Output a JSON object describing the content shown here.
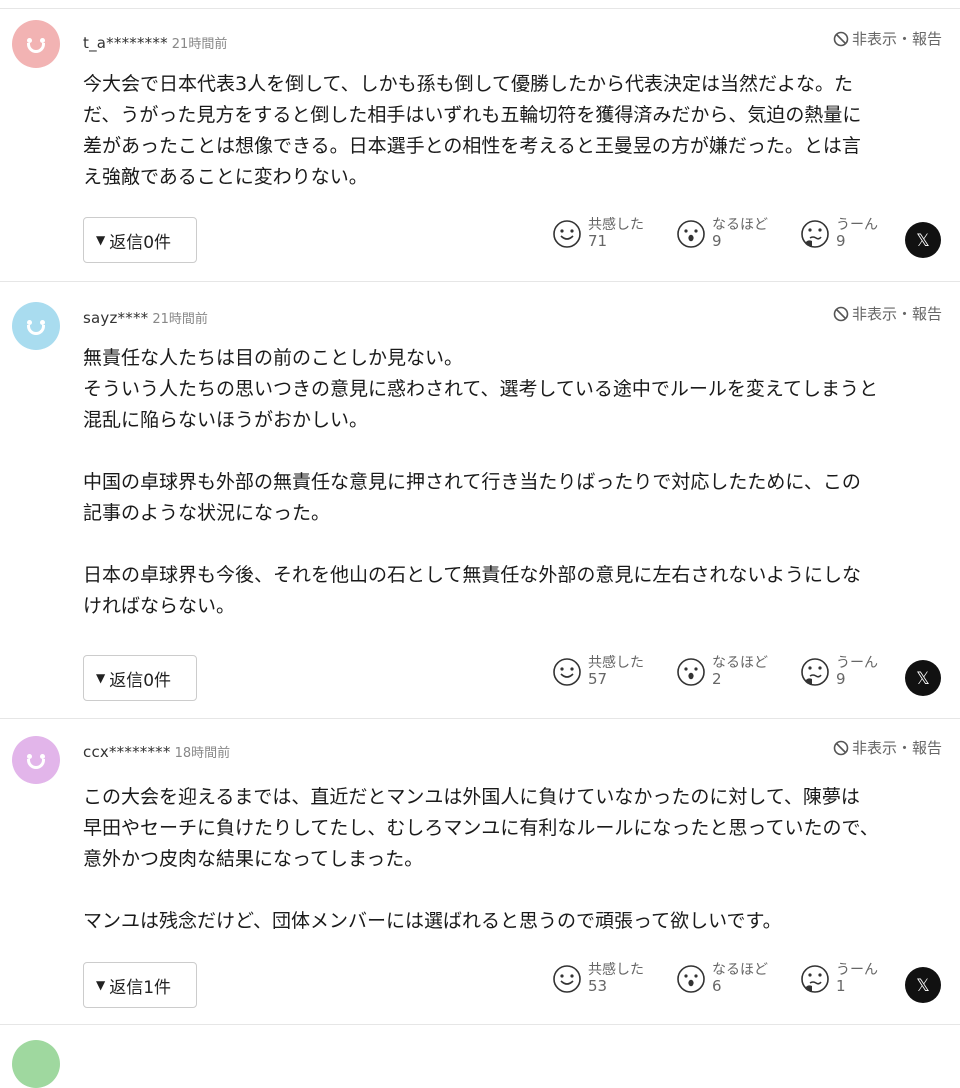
{
  "ui": {
    "hide_report": "非表示・報告",
    "reaction_labels": {
      "empathy": "共感した",
      "indeed": "なるほど",
      "hmm": "うーん"
    }
  },
  "comments": [
    {
      "user": "t_a********",
      "time": "21時間前",
      "avatar_color": "#f2b3b3",
      "lines": [
        "今大会で日本代表3人を倒して、しかも孫も倒して優勝したから代表決定は当然だよな。た",
        "だ、うがった見方をすると倒した相手はいずれも五輪切符を獲得済みだから、気迫の熱量に",
        "差があったことは想像できる。日本選手との相性を考えると王曼昱の方が嫌だった。とは言",
        "え強敵であることに変わりない。"
      ],
      "reply_label": "返信0件",
      "counts": {
        "empathy": "71",
        "indeed": "9",
        "hmm": "9"
      }
    },
    {
      "user": "sayz****",
      "time": "21時間前",
      "avatar_color": "#a9dcef",
      "lines": [
        "無責任な人たちは目の前のことしか見ない。",
        "そういう人たちの思いつきの意見に惑わされて、選考している途中でルールを変えてしまうと",
        "混乱に陥らないほうがおかしい。",
        "",
        "中国の卓球界も外部の無責任な意見に押されて行き当たりばったりで対応したために、この",
        "記事のような状況になった。",
        "",
        "日本の卓球界も今後、それを他山の石として無責任な外部の意見に左右されないようにしな",
        "ければならない。"
      ],
      "reply_label": "返信0件",
      "counts": {
        "empathy": "57",
        "indeed": "2",
        "hmm": "9"
      }
    },
    {
      "user": "ccx********",
      "time": "18時間前",
      "avatar_color": "#e2b5ea",
      "lines": [
        "この大会を迎えるまでは、直近だとマンユは外国人に負けていなかったのに対して、陳夢は",
        "早田やセーチに負けたりしてたし、むしろマンユに有利なルールになったと思っていたので、",
        "意外かつ皮肉な結果になってしまった。",
        "",
        "マンユは残念だけど、団体メンバーには選ばれると思うので頑張って欲しいです。"
      ],
      "reply_label": "返信1件",
      "counts": {
        "empathy": "53",
        "indeed": "6",
        "hmm": "1"
      }
    }
  ],
  "next_avatar_color": "#9fd89f"
}
